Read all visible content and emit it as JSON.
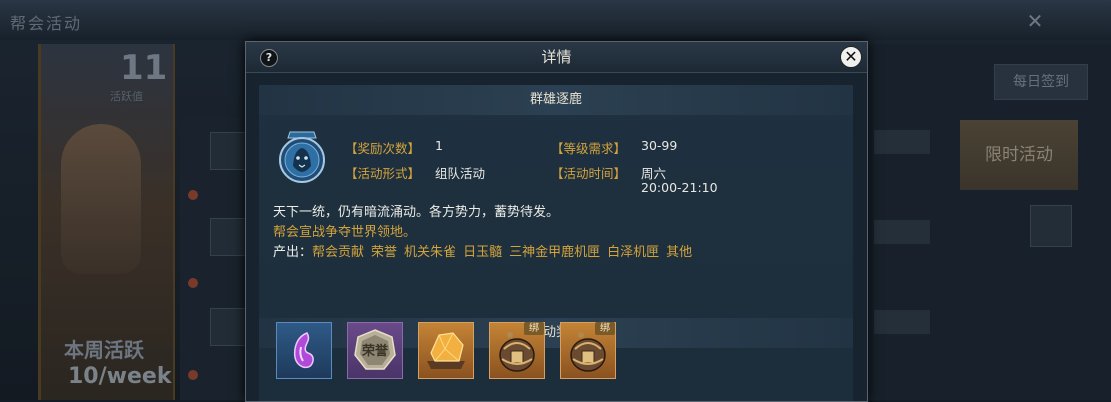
{
  "background": {
    "window_title": "帮会活动",
    "close_symbol": "✕",
    "count": "11",
    "count_label": "活跃值",
    "bottom_label": "本周活跃",
    "bottom_value": "10/week",
    "right_buttons": [
      "每日签到",
      "限时活动"
    ]
  },
  "dialog": {
    "title": "详情",
    "help_symbol": "?",
    "close_symbol": "✕",
    "activity_name": "群雄逐鹿",
    "emblem_icon": "lion-crest-icon",
    "fields": {
      "reward_count_label": "【奖励次数】",
      "reward_count_value": "1",
      "level_req_label": "【等级需求】",
      "level_req_value": "30-99",
      "form_label": "【活动形式】",
      "form_value": "组队活动",
      "time_label": "【活动时间】",
      "time_day": "周六",
      "time_range": "20:00-21:10"
    },
    "description_line1": "天下一统，仍有暗流涌动。各方势力，蓄势待发。",
    "description_line2": "帮会宣战争夺世界领地。",
    "output_label": "产出：",
    "outputs": [
      "帮会贡献",
      "荣誉",
      "机关朱雀",
      "日玉髓",
      "三神金甲鹿机匣",
      "白泽机匣",
      "其他"
    ],
    "rewards_title": "活动奖励",
    "rewards": [
      {
        "icon": "purple-gem-icon",
        "bound": ""
      },
      {
        "icon": "honor-medal-icon",
        "bound": ""
      },
      {
        "icon": "amber-ore-icon",
        "bound": ""
      },
      {
        "icon": "mech-box-icon",
        "bound": "绑"
      },
      {
        "icon": "mech-box-icon",
        "bound": "绑"
      }
    ],
    "medal_text": "荣誉"
  },
  "colors": {
    "label_gold": "#d4a43c",
    "value_white": "#e8e8e4",
    "panel_bg": "#1f3140",
    "reward_blue_border": "#3a6a9a",
    "reward_purple_bg": "#5a4a7a",
    "reward_orange_bg": "#a8662a"
  }
}
